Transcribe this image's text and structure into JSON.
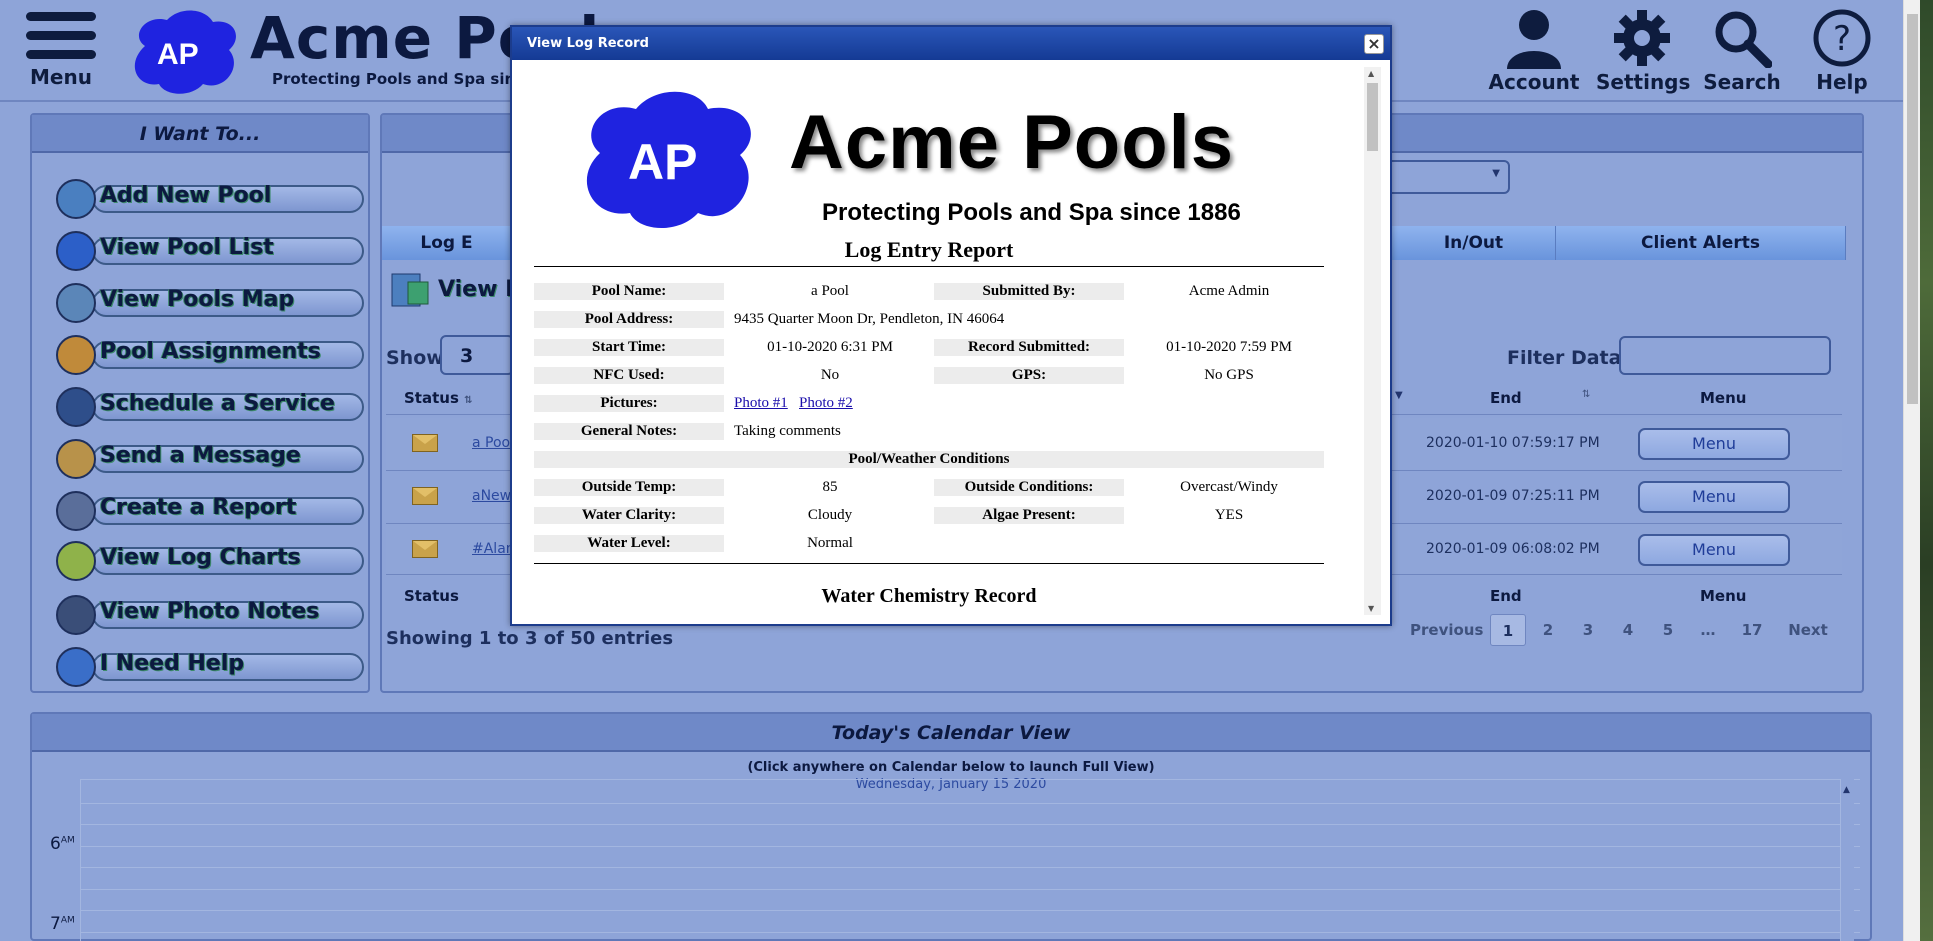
{
  "header": {
    "menu_label": "Menu",
    "logo_text": "AP",
    "brand": "Acme Pool",
    "tagline": "Protecting Pools and Spa since 188",
    "nav": [
      {
        "label": "Account",
        "icon": "account-icon"
      },
      {
        "label": "Settings",
        "icon": "gear-icon"
      },
      {
        "label": "Search",
        "icon": "search-icon"
      },
      {
        "label": "Help",
        "icon": "help-icon"
      }
    ]
  },
  "want": {
    "title": "I Want To...",
    "items": [
      {
        "label": "Add New Pool",
        "icon": "house-icon"
      },
      {
        "label": "View Pool List",
        "icon": "list-icon"
      },
      {
        "label": "View Pools Map",
        "icon": "map-icon"
      },
      {
        "label": "Pool Assignments",
        "icon": "assignments-icon"
      },
      {
        "label": "Schedule a Service",
        "icon": "calendar-icon"
      },
      {
        "label": "Send a Message",
        "icon": "message-icon"
      },
      {
        "label": "Create a Report",
        "icon": "report-icon"
      },
      {
        "label": "View Log Charts",
        "icon": "pie-chart-icon"
      },
      {
        "label": "View Photo Notes",
        "icon": "camera-icon"
      },
      {
        "label": "I Need Help",
        "icon": "help-icon"
      }
    ]
  },
  "main": {
    "tabs": [
      "Log E",
      "In/Out",
      "Client Alerts"
    ],
    "section_title": "View L",
    "show_label": "Show",
    "show_value": "3",
    "filter_label": "Filter Data:",
    "filter_value": "",
    "columns": {
      "status": "Status",
      "end": "End",
      "menu": "Menu"
    },
    "rows": [
      {
        "name": "a Pool",
        "end": "2020-01-10 07:59:17 PM",
        "menu": "Menu"
      },
      {
        "name": "aNew",
        "end": "2020-01-09 07:25:11 PM",
        "menu": "Menu"
      },
      {
        "name": "#Alan",
        "end": "2020-01-09 06:08:02 PM",
        "menu": "Menu"
      }
    ],
    "showing": "Showing 1 to 3 of 50 entries",
    "pagination": [
      "Previous",
      "1",
      "2",
      "3",
      "4",
      "5",
      "…",
      "17",
      "Next"
    ]
  },
  "calendar": {
    "title": "Today's Calendar View",
    "hint": "(Click anywhere on Calendar below to launch Full View)",
    "date": "Wednesday, January 15 2020",
    "hours": [
      {
        "h": "6",
        "ap": "AM"
      },
      {
        "h": "7",
        "ap": "AM"
      }
    ]
  },
  "modal": {
    "title": "View Log Record",
    "close": "×",
    "logo_text": "AP",
    "brand": "Acme Pools",
    "tagline": "Protecting Pools and Spa since 1886",
    "report_title": "Log Entry Report",
    "fields": {
      "pool_name_l": "Pool Name:",
      "pool_name": "a Pool",
      "submitted_by_l": "Submitted By:",
      "submitted_by": "Acme Admin",
      "address_l": "Pool Address:",
      "address": "9435 Quarter Moon Dr, Pendleton, IN 46064",
      "start_l": "Start Time:",
      "start": "01-10-2020 6:31 PM",
      "record_l": "Record Submitted:",
      "record": "01-10-2020 7:59 PM",
      "nfc_l": "NFC Used:",
      "nfc": "No",
      "gps_l": "GPS:",
      "gps": "No GPS",
      "pictures_l": "Pictures:",
      "photo1": "Photo #1",
      "photo2": "Photo #2",
      "notes_l": "General Notes:",
      "notes": "Taking comments",
      "weather_section": "Pool/Weather Conditions",
      "temp_l": "Outside Temp:",
      "temp": "85",
      "cond_l": "Outside Conditions:",
      "cond": "Overcast/Windy",
      "clarity_l": "Water Clarity:",
      "clarity": "Cloudy",
      "algae_l": "Algae Present:",
      "algae": "YES",
      "level_l": "Water Level:",
      "level": "Normal",
      "next_section": "Water Chemistry Record"
    }
  }
}
